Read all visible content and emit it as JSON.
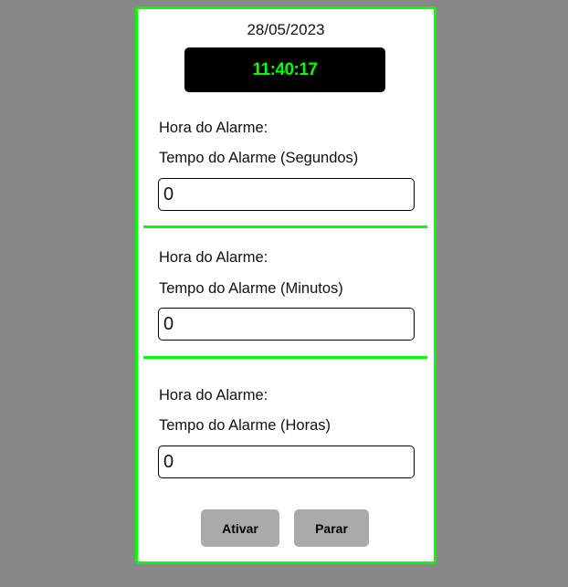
{
  "date": "28/05/2023",
  "clock": "11:40:17",
  "sections": [
    {
      "alarm_label": "Hora do Alarme:",
      "time_label": "Tempo do Alarme (Segundos)",
      "value": "0"
    },
    {
      "alarm_label": "Hora do Alarme:",
      "time_label": "Tempo do Alarme (Minutos)",
      "value": "0"
    },
    {
      "alarm_label": "Hora do Alarme:",
      "time_label": "Tempo do Alarme (Horas)",
      "value": "0"
    }
  ],
  "buttons": {
    "activate": "Ativar",
    "stop": "Parar"
  },
  "colors": {
    "accent": "#00ff00",
    "background": "#888888",
    "clock_bg": "#000000",
    "button": "#aaaaaa"
  }
}
